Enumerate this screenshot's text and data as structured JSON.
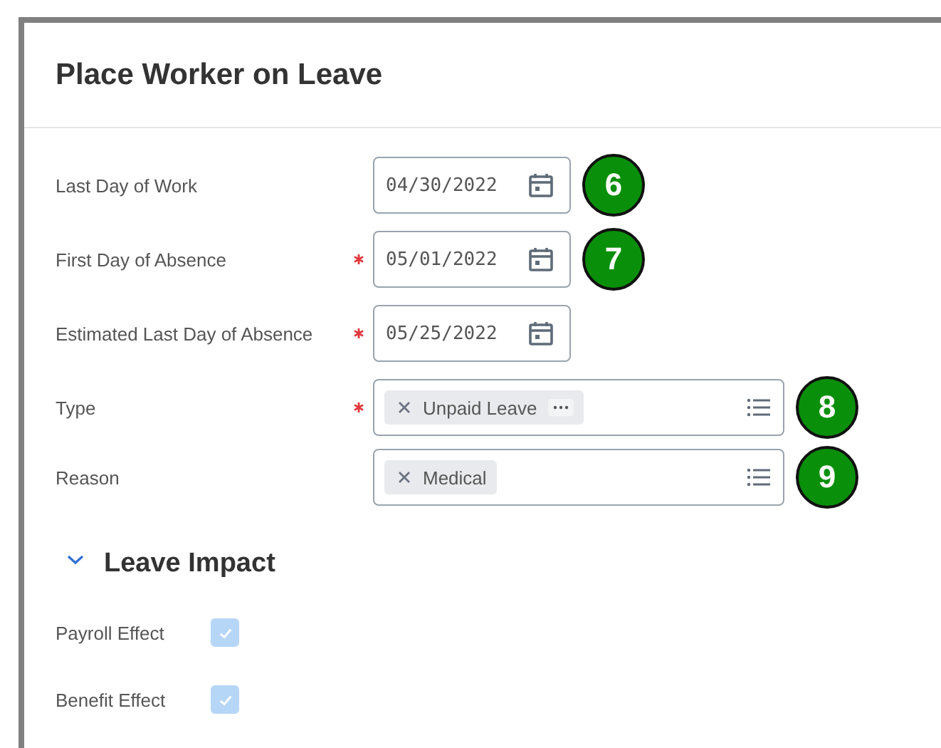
{
  "title": "Place Worker on Leave",
  "fields": [
    {
      "kind": "date",
      "label": "Last Day of Work",
      "required": false,
      "value": "04/30/2022",
      "badge": "6"
    },
    {
      "kind": "date",
      "label": "First Day of Absence",
      "required": true,
      "value": "05/01/2022",
      "badge": "7"
    },
    {
      "kind": "date",
      "label": "Estimated Last Day of Absence",
      "required": true,
      "value": "05/25/2022"
    },
    {
      "kind": "multiselect",
      "label": "Type",
      "required": true,
      "tokens": [
        {
          "label": "Unpaid Leave",
          "has_more": true
        }
      ],
      "badge": "8"
    },
    {
      "kind": "multiselect",
      "label": "Reason",
      "required": false,
      "tokens": [
        {
          "label": "Medical",
          "has_more": false
        }
      ],
      "badge": "9"
    }
  ],
  "section": {
    "title": "Leave Impact",
    "expanded": true,
    "checkboxes": [
      {
        "label": "Payroll Effect",
        "checked": true,
        "disabled": true
      },
      {
        "label": "Benefit Effect",
        "checked": true,
        "disabled": true
      }
    ]
  }
}
